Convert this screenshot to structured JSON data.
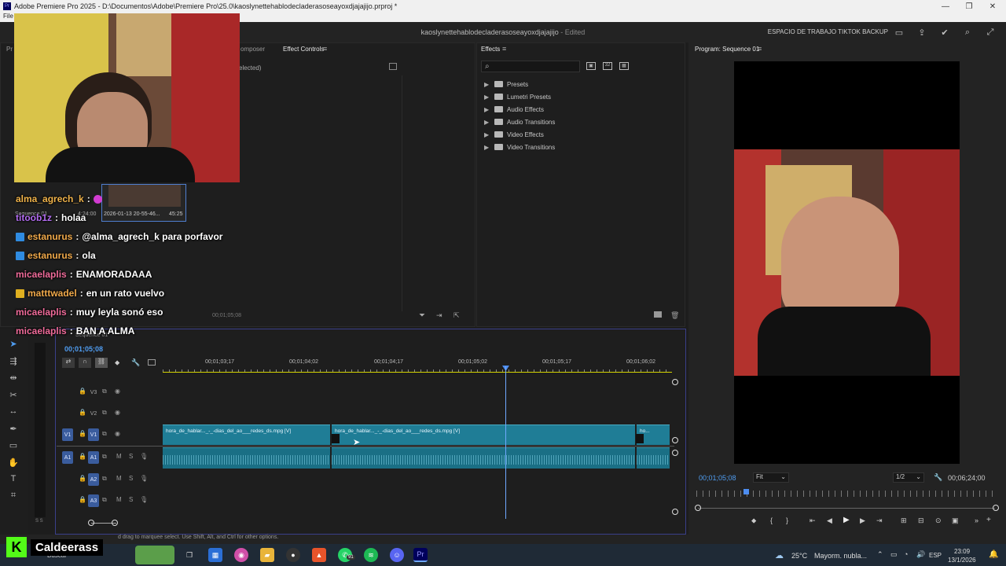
{
  "window": {
    "title": "Adobe Premiere Pro 2025 - D:\\Documentos\\Adobe\\Premiere Pro\\25.0\\kaoslynettehablodecladerasoseayoxdjajajijo.prproj *",
    "menu_first": "File"
  },
  "header": {
    "doc_name": "kaoslynettehablodecladerasoseayoxdjajajijo",
    "doc_status": " - Edited",
    "workspace": "ESPACIO DE TRABAJO TIKTOK BACKUP"
  },
  "panels": {
    "source_tab_partial": "Pr",
    "composer_tab": "omposer",
    "effect_controls_tab": "Effect Controls",
    "effect_controls_empty": "elected)",
    "effect_controls_time": "00;01;05;08",
    "effects_tab": "Effects",
    "program_tab": "Program: Sequence 01",
    "project_item_date": "2026-01-13 20-55-46...",
    "project_item_duration": "45:25",
    "project_seq_label": "Sequence 01",
    "project_seq_duration": "4:24:00"
  },
  "effects": {
    "items": [
      "Presets",
      "Lumetri Presets",
      "Audio Effects",
      "Audio Transitions",
      "Video Effects",
      "Video Transitions"
    ]
  },
  "program": {
    "timecode": "00;01;05;08",
    "fit": "Fit",
    "resolution": "1/2",
    "duration": "00;06;24;00"
  },
  "timeline": {
    "tab": "Sequence 01",
    "timecode": "00;01;05;08",
    "ruler": [
      "00;01;03;17",
      "00;01;04;02",
      "00;01;04;17",
      "00;01;05;02",
      "00;01;05;17",
      "00;01;06;02"
    ],
    "tracks": [
      "V3",
      "V2",
      "V1",
      "A1",
      "A2",
      "A3"
    ],
    "source_v": "V1",
    "source_a": "A1",
    "clip1_name": "hora_de_hablar..._-_-dias_del_ao___redes_ds.mpg [V]",
    "clip2_name": "hora_de_hablar..._-_-dias_del_ao___redes_ds.mpg [V]",
    "clip3_name": "ho..."
  },
  "status": {
    "text": "d drag to marquee select. Use Shift, Alt, and Ctrl for other options."
  },
  "chat": [
    {
      "user": "alma_agrech_k",
      "msg": "",
      "color": "#f0b34a",
      "badge": ""
    },
    {
      "user": "titoob1z",
      "msg": "holaa",
      "color": "#b26cf0",
      "badge": ""
    },
    {
      "user": "estanurus",
      "msg": "@alma_agrech_k para porfavor",
      "color": "#f0a94a",
      "badge": "#2f8be0"
    },
    {
      "user": "estanurus",
      "msg": "ola",
      "color": "#f0a94a",
      "badge": "#2f8be0"
    },
    {
      "user": "micaelaplis",
      "msg": "ENAMORADAAA",
      "color": "#f06b9a",
      "badge": ""
    },
    {
      "user": "matttwadel",
      "msg": "en un rato vuelvo",
      "color": "#f0a94a",
      "badge": "#e0b020"
    },
    {
      "user": "micaelaplis",
      "msg": "muy leyla sonó eso",
      "color": "#f06b9a",
      "badge": ""
    },
    {
      "user": "micaelaplis",
      "msg": "BAN A ALMA",
      "color": "#f06b9a",
      "badge": ""
    }
  ],
  "brand": {
    "letter": "K",
    "name": "Caldeerass"
  },
  "taskbar": {
    "search": "Buscar",
    "whatsapp_badge": "91",
    "weather_temp": "25°C",
    "weather_text": "Mayorm. nubla...",
    "lang": "ESP",
    "time": "23:09",
    "date": "13/1/2026"
  },
  "colors": {
    "accent_blue": "#4f9cf0",
    "clip_video": "#1f7d96",
    "clip_audio": "#1a6f85",
    "track_target": "#3a5c9d",
    "kick_green": "#53fc18"
  }
}
